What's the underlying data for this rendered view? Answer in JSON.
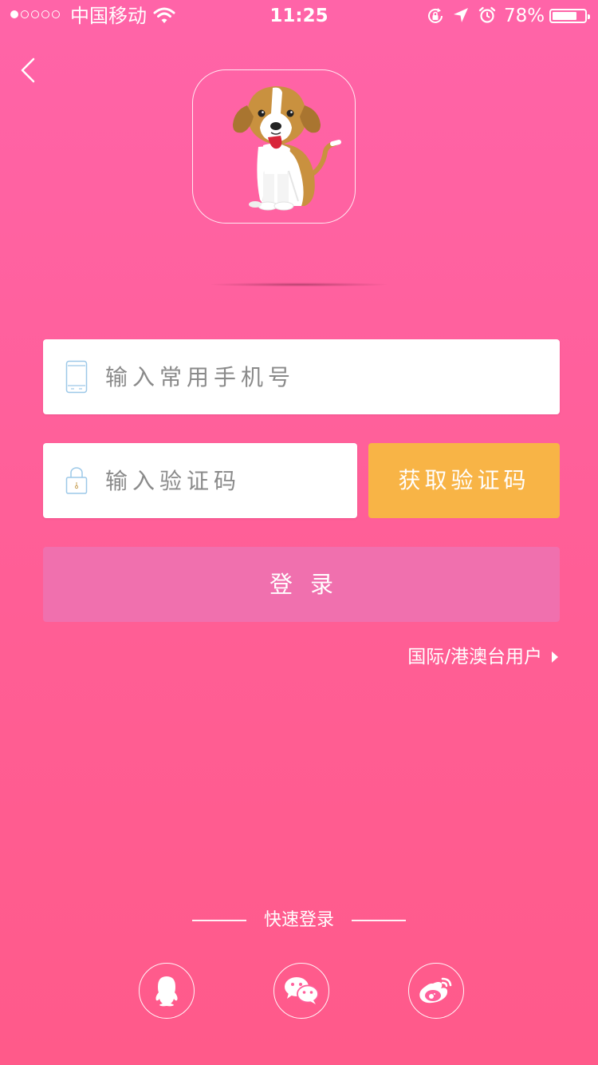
{
  "status_bar": {
    "carrier": "中国移动",
    "time": "11:25",
    "battery_percent": "78%",
    "battery_level": 0.78,
    "signal_bars_filled": 1,
    "signal_bars_total": 5
  },
  "login": {
    "phone_placeholder": "输入常用手机号",
    "code_placeholder": "输入验证码",
    "get_code_label": "获取验证码",
    "login_label": "登录",
    "intl_link_label": "国际/港澳台用户"
  },
  "quick_login": {
    "title": "快速登录",
    "providers": [
      "qq-icon",
      "wechat-icon",
      "weibo-icon"
    ]
  },
  "colors": {
    "background_top": "#ff64a8",
    "background_bottom": "#ff5a8a",
    "get_code_button": "#f8b446",
    "login_button": "#f070ae",
    "field_icon": "#9cc8e8"
  }
}
